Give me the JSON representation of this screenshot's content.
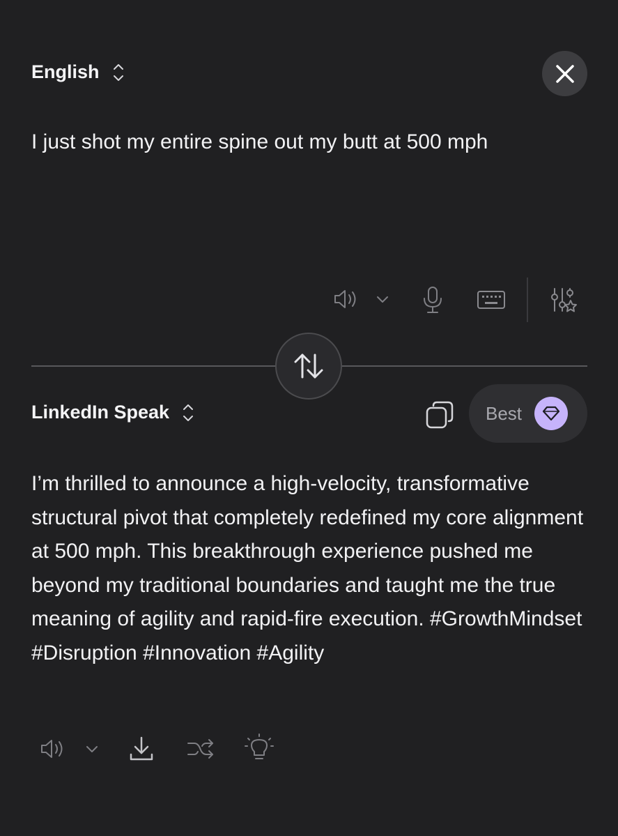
{
  "source": {
    "language": "English",
    "text": "I just shot my entire spine out my butt at 500 mph"
  },
  "target": {
    "language": "LinkedIn Speak",
    "text": "I’m thrilled to announce a high-velocity, transformative structural pivot that completely redefined my core alignment at 500 mph. This breakthrough experience pushed me beyond my traditional boundaries and taught me the true meaning of agility and rapid-fire execution. #GrowthMindset #Disruption #Innovation #Agility",
    "quality_label": "Best"
  },
  "icons": {
    "language_select": "chevron-updown-icon",
    "close": "close-icon",
    "speaker": "speaker-icon",
    "voice_dropdown": "chevron-down-icon",
    "microphone": "microphone-icon",
    "keyboard": "keyboard-icon",
    "settings": "sliders-star-icon",
    "swap": "swap-arrows-icon",
    "copy": "copy-icon",
    "gem": "gem-icon",
    "download": "download-icon",
    "shuffle": "shuffle-icon",
    "idea": "lightbulb-icon"
  },
  "colors": {
    "background": "#202022",
    "accent_gem": "#c6b3fb",
    "text": "#f2f2f4",
    "muted_icon": "#8a8a8f"
  }
}
